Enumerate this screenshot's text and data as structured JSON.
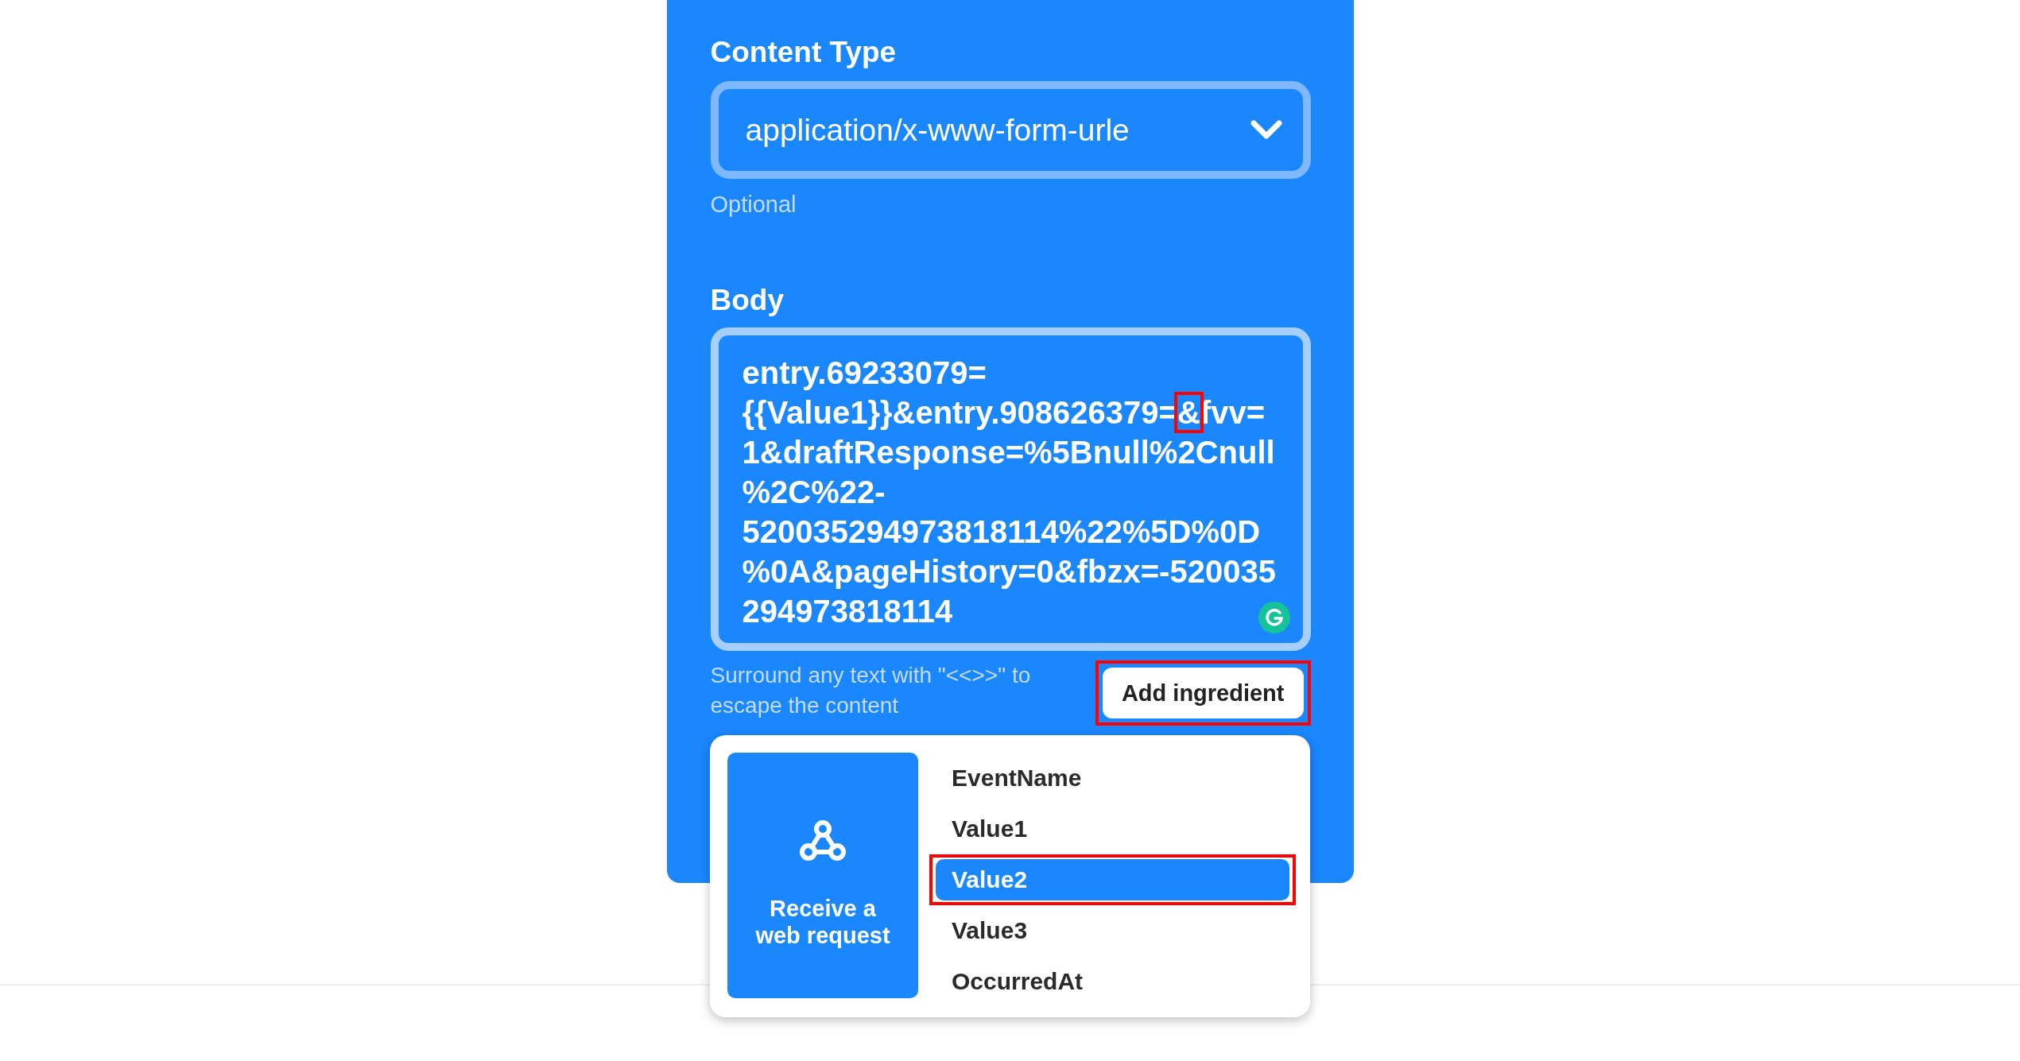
{
  "content_type": {
    "label": "Content Type",
    "value": "application/x-www-form-urle",
    "hint": "Optional"
  },
  "body": {
    "label": "Body",
    "value_before": "entry.69233079={{Value1}}&entry.908626379=",
    "highlighted_part": "&",
    "value_after": "fvv=1&draftResponse=%5Bnull%2Cnull%2C%22-520035294973818114%22%5D%0D%0A&pageHistory=0&fbzx=-520035294973818114",
    "hint": "Surround any text with \"<<>>\" to escape the content"
  },
  "add_button": {
    "label": "Add ingredient",
    "highlighted": true
  },
  "ingredients": {
    "source": "Receive a web request",
    "items": [
      {
        "label": "EventName",
        "selected": false,
        "highlighted": false
      },
      {
        "label": "Value1",
        "selected": false,
        "highlighted": false
      },
      {
        "label": "Value2",
        "selected": true,
        "highlighted": true
      },
      {
        "label": "Value3",
        "selected": false,
        "highlighted": false
      },
      {
        "label": "OccurredAt",
        "selected": false,
        "highlighted": false
      }
    ]
  }
}
